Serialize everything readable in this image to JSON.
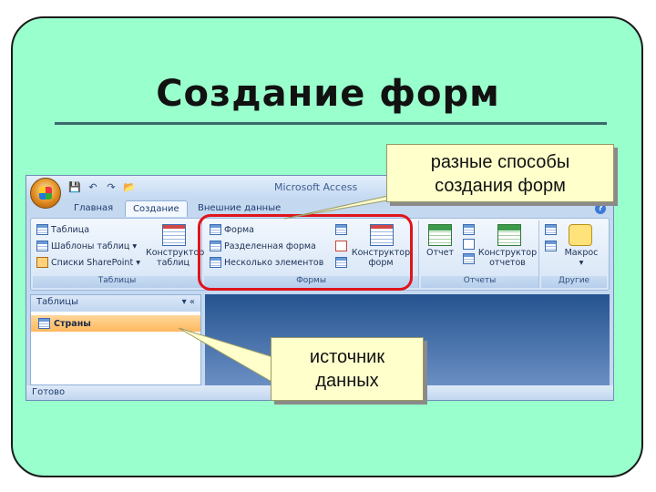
{
  "slide": {
    "title": "Создание форм"
  },
  "window": {
    "title": "Microsoft Access",
    "qat_icons": [
      "save-icon",
      "undo-icon",
      "redo-icon",
      "open-icon"
    ],
    "tabs": [
      {
        "label": "Главная",
        "active": false
      },
      {
        "label": "Создание",
        "active": true
      },
      {
        "label": "Внешние данные",
        "active": false
      }
    ]
  },
  "ribbon": {
    "groups": [
      {
        "label": "Таблицы",
        "items": [
          "Таблица",
          "Шаблоны таблиц ▾",
          "Списки SharePoint ▾"
        ],
        "big_button": "Конструктор\nтаблиц"
      },
      {
        "label": "Формы",
        "items": [
          "Форма",
          "Разделенная форма",
          "Несколько элементов"
        ],
        "big_button": "Конструктор\nформ"
      },
      {
        "label": "Отчеты",
        "items": [
          "Отчет"
        ],
        "big_button": "Конструктор\nотчетов"
      },
      {
        "label": "Другие",
        "items": [],
        "big_button": "Макрос\n▾"
      }
    ]
  },
  "nav_pane": {
    "header": "Таблицы",
    "header_controls": "▾  «",
    "items": [
      "Страны"
    ]
  },
  "status": "Готово",
  "callouts": {
    "ways": "разные способы\nсоздания форм",
    "source": "источник\nданных"
  },
  "colors": {
    "slide_background": "#99ffcc",
    "highlight": "#e0141c",
    "callout_fill": "#ffffcc"
  }
}
